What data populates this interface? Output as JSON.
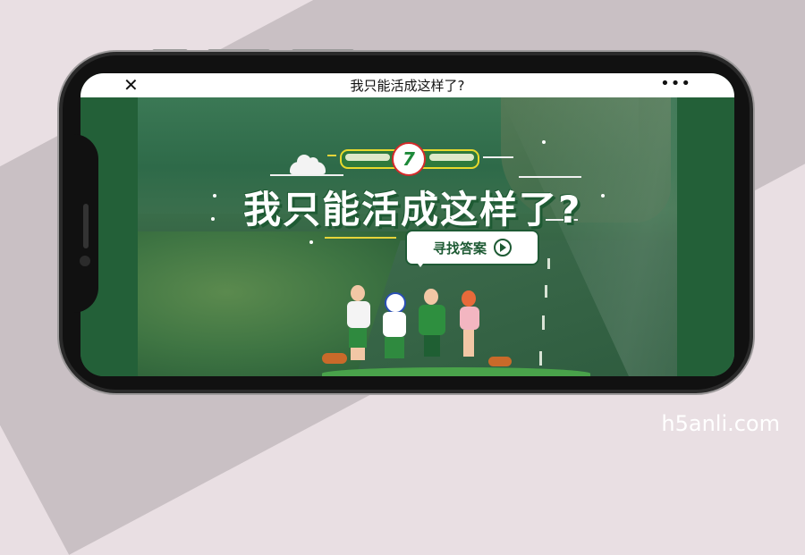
{
  "window": {
    "title": "我只能活成这样了?",
    "close_icon": "close-icon",
    "more_icon": "more-dots-icon"
  },
  "hero": {
    "brand_logo_text": "7",
    "headline": "我只能活成这样了?",
    "cta_label": "寻找答案",
    "cta_icon": "play-circle-icon"
  },
  "colors": {
    "primary_green": "#1f5c36",
    "accent_yellow": "#e8d92c",
    "cta_text": "#1d5a33"
  },
  "watermark": "h5anli.com"
}
